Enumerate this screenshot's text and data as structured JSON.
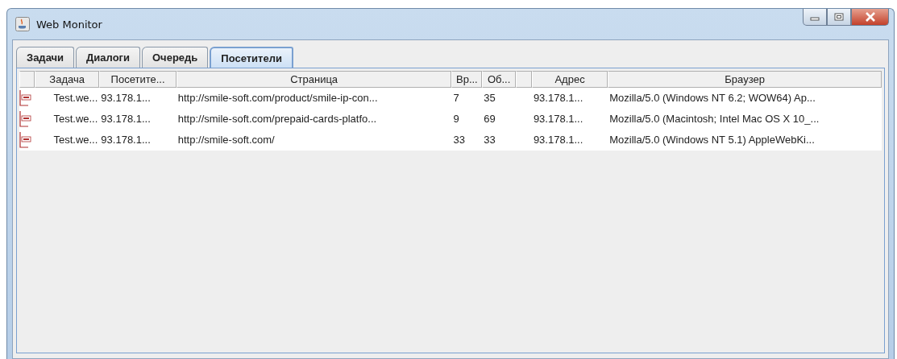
{
  "window": {
    "title": "Web Monitor"
  },
  "tabs": [
    {
      "label": "Задачи",
      "selected": false
    },
    {
      "label": "Диалоги",
      "selected": false
    },
    {
      "label": "Очередь",
      "selected": false
    },
    {
      "label": "Посетители",
      "selected": true
    }
  ],
  "table": {
    "columns": [
      {
        "kind": "icon"
      },
      {
        "kind": "text",
        "label": "Задача"
      },
      {
        "kind": "text",
        "label": "Посетите..."
      },
      {
        "kind": "text",
        "label": "Страница"
      },
      {
        "kind": "text",
        "label": "Вр..."
      },
      {
        "kind": "text",
        "label": "Об..."
      },
      {
        "kind": "blank"
      },
      {
        "kind": "text",
        "label": "Адрес"
      },
      {
        "kind": "text",
        "label": "Браузер"
      }
    ],
    "rows": [
      {
        "cells": [
          "",
          "Test.we...",
          "93.178.1...",
          "http://smile-soft.com/product/smile-ip-con...",
          "7",
          "35",
          "",
          "93.178.1...",
          "Mozilla/5.0 (Windows NT 6.2; WOW64) Ap..."
        ]
      },
      {
        "cells": [
          "",
          "Test.we...",
          "93.178.1...",
          "http://smile-soft.com/prepaid-cards-platfo...",
          "9",
          "69",
          "",
          "93.178.1...",
          "Mozilla/5.0 (Macintosh; Intel Mac OS X 10_..."
        ]
      },
      {
        "cells": [
          "",
          "Test.we...",
          "93.178.1...",
          "http://smile-soft.com/",
          "33",
          "33",
          "",
          "93.178.1...",
          "Mozilla/5.0 (Windows NT 5.1) AppleWebKi..."
        ]
      }
    ]
  }
}
